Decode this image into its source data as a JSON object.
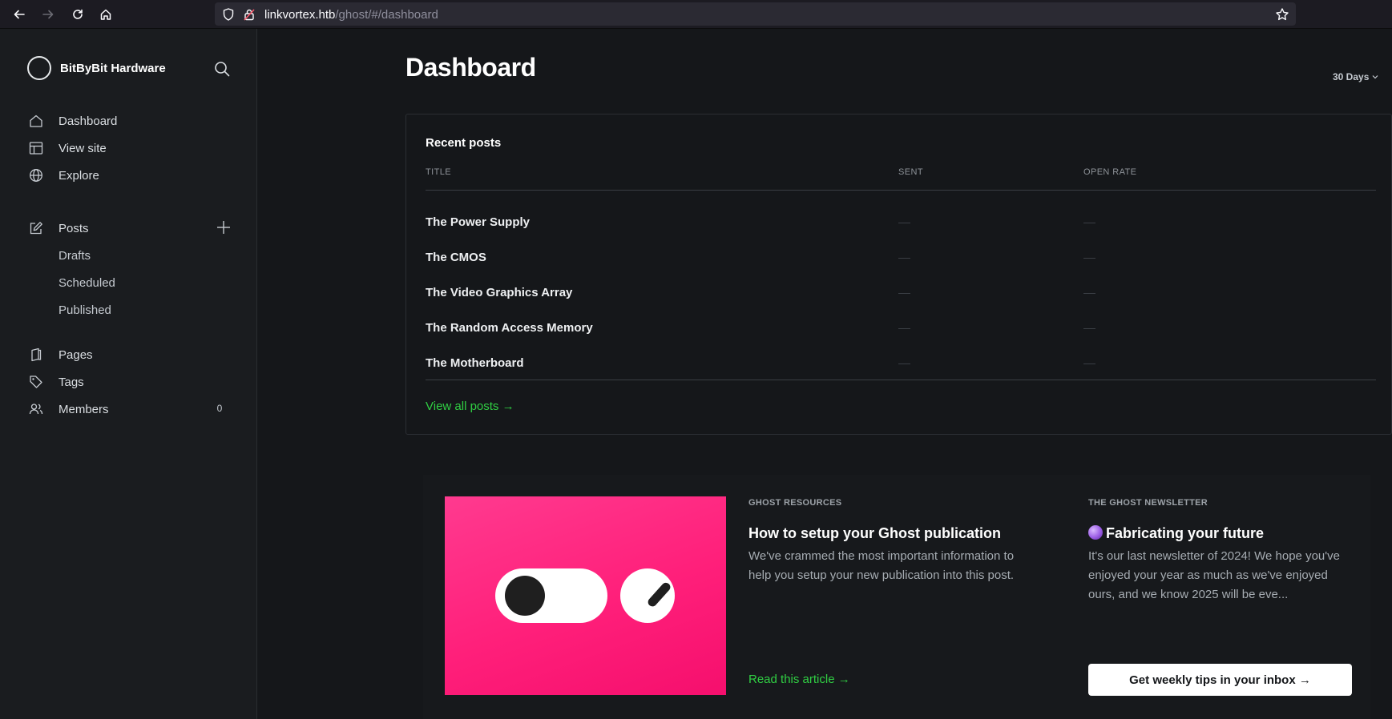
{
  "browser": {
    "url_host": "linkvortex.htb",
    "url_path": "/ghost/#/dashboard"
  },
  "sidebar": {
    "brand_name": "BitByBit Hardware",
    "nav": [
      {
        "label": "Dashboard",
        "icon": "home-icon"
      },
      {
        "label": "View site",
        "icon": "layout-icon"
      },
      {
        "label": "Explore",
        "icon": "globe-icon"
      }
    ],
    "posts": {
      "label": "Posts",
      "icon": "edit-icon",
      "sub": [
        "Drafts",
        "Scheduled",
        "Published"
      ]
    },
    "more": [
      {
        "label": "Pages",
        "icon": "pages-icon"
      },
      {
        "label": "Tags",
        "icon": "tag-icon"
      },
      {
        "label": "Members",
        "icon": "members-icon"
      }
    ],
    "members_count": "0"
  },
  "main": {
    "title": "Dashboard",
    "range": "30 Days",
    "recent_posts": {
      "heading": "Recent posts",
      "columns": [
        "TITLE",
        "SENT",
        "OPEN RATE"
      ],
      "rows": [
        {
          "title": "The Power Supply"
        },
        {
          "title": "The CMOS"
        },
        {
          "title": "The Video Graphics Array"
        },
        {
          "title": "The Random Access Memory"
        },
        {
          "title": "The Motherboard"
        }
      ],
      "view_all": "View all posts →"
    },
    "resources": {
      "eyebrow": "GHOST RESOURCES",
      "headline": "How to setup your Ghost publication",
      "body": "We've crammed the most important information to help you setup your new publication into this post.",
      "cta": "Read this article →"
    },
    "newsletter": {
      "eyebrow": "THE GHOST NEWSLETTER",
      "headline": "Fabricating your future",
      "body": "It's our last newsletter of 2024! We hope you've enjoyed your year as much as we've enjoyed ours, and we know 2025 will be eve...",
      "cta": "Get weekly tips in your inbox →"
    }
  },
  "colors": {
    "accent_green": "#30cf43",
    "resource_pink": "#ff1f7a"
  }
}
